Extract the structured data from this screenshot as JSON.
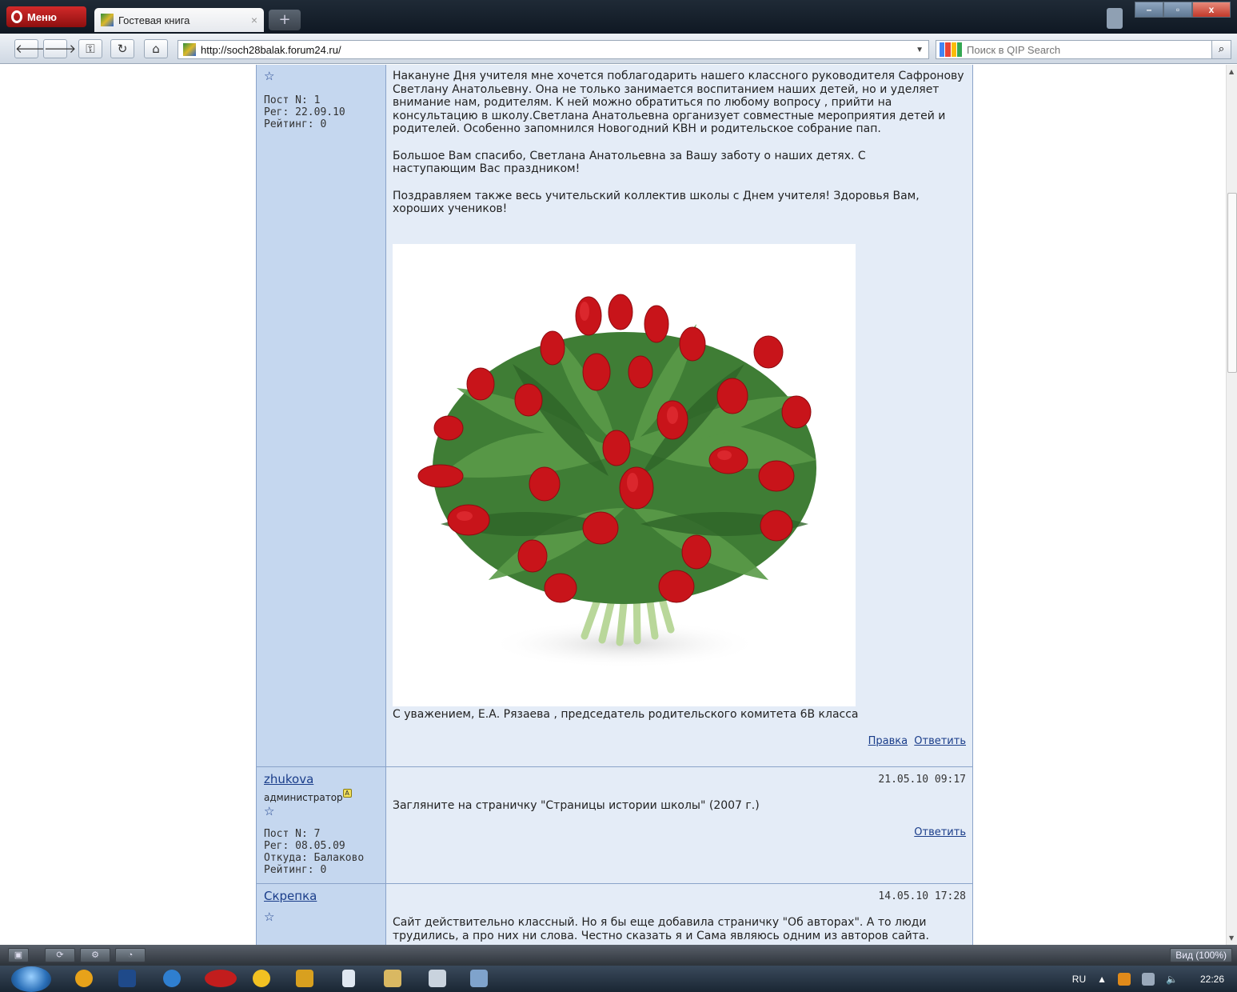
{
  "browser": {
    "menu_label": "Меню",
    "tab_title": "Гостевая книга",
    "tab_close": "×",
    "new_tab": "+",
    "url": "http://soch28balak.forum24.ru/",
    "search_placeholder": "Поиск в QIP Search",
    "zoom": "Вид (100%)"
  },
  "posts": [
    {
      "left": {
        "star": "☆",
        "post_no": "Пост N: 1",
        "reg": "Рег: 22.09.10",
        "rating": "Рейтинг: 0"
      },
      "paragraphs": [
        "Накануне Дня учителя мне хочется поблагодарить нашего классного руководителя Сафронову Светлану Анатольевну. Она не только занимается воспитанием наших детей, но и уделяет внимание нам, родителям. К ней можно обратиться по любому вопросу , прийти на консультацию в школу.Светлана Анатольевна организует совместные мероприятия детей и родителей. Особенно запомнился Новогодний КВН и родительское собрание пап.",
        "Большое Вам спасибо, Светлана Анатольевна за Вашу заботу о наших детях. С наступающим Вас праздником!",
        "Поздравляем также весь учительский коллектив школы с Днем учителя! Здоровья Вам, хороших учеников!"
      ],
      "signature": "С уважением, Е.А. Рязаева , председатель родительского комитета 6В класса",
      "link_edit": "Правка",
      "link_reply": "Ответить"
    },
    {
      "left": {
        "author": "zhukova",
        "role": "администратор",
        "badge": "A",
        "star": "☆",
        "post_no": "Пост N: 7",
        "reg": "Рег: 08.05.09",
        "from": "Откуда: Балаково",
        "rating": "Рейтинг: 0"
      },
      "date": "21.05.10 09:17",
      "text": "Загляните на страничку \"Страницы истории школы\" (2007 г.)",
      "link_reply": "Ответить"
    },
    {
      "left": {
        "author": "Скрепка",
        "star": "☆"
      },
      "date": "14.05.10 17:28",
      "text": "Сайт действительно классный. Но я бы еще добавила страничку \"Об авторах\". А то люди трудились, а про них ни слова. Честно сказать я и Сама являюсь одним из авторов сайта."
    }
  ],
  "taskbar": {
    "lang": "RU",
    "time": "22:26"
  },
  "colors": {
    "left_column": "#c5d7ef",
    "right_column": "#e4ecf7",
    "border": "#8aa3c9",
    "link": "#1a3d8a",
    "tulip_red": "#c8141a",
    "leaf_green": "#3c7a34"
  },
  "icons": [
    "back-icon",
    "forward-icon",
    "key-icon",
    "reload-icon",
    "home-icon",
    "search-icon",
    "windows-start-icon"
  ]
}
